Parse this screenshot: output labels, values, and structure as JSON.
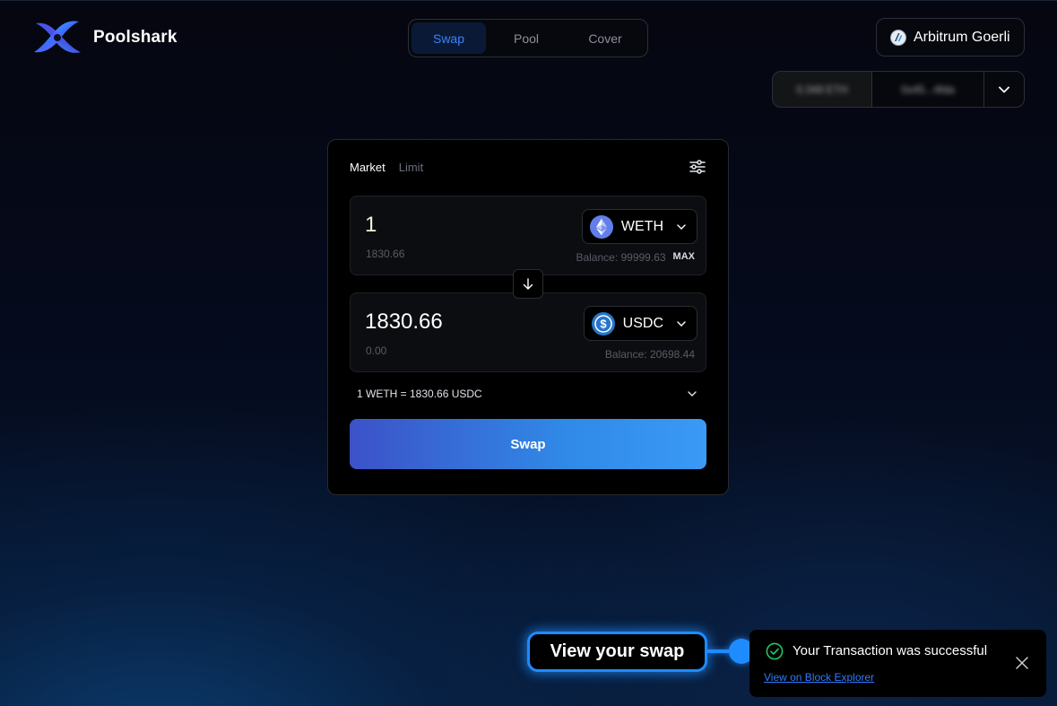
{
  "header": {
    "app_name": "Poolshark",
    "nav_tabs": [
      {
        "label": "Swap",
        "active": true
      },
      {
        "label": "Pool",
        "active": false
      },
      {
        "label": "Cover",
        "active": false
      }
    ],
    "network_label": "Arbitrum Goerli",
    "network_icon": "arbitrum-icon",
    "wallet_balance": "0.349 ETH",
    "wallet_address": "0x45...4fda"
  },
  "swap": {
    "mode_tabs": [
      "Market",
      "Limit"
    ],
    "active_mode": "Market",
    "from": {
      "amount": "1",
      "usd_value": "1830.66",
      "token": "WETH",
      "token_icon": "ethereum-icon",
      "balance_label": "Balance: 99999.63",
      "max_label": "MAX"
    },
    "to": {
      "amount": "1830.66",
      "usd_value": "0.00",
      "token": "USDC",
      "token_icon": "usdc-icon",
      "balance_label": "Balance: 20698.44"
    },
    "rate_text": "1 WETH = 1830.66 USDC",
    "button_label": "Swap"
  },
  "callout": {
    "text": "View your swap"
  },
  "toast": {
    "message": "Your Transaction was successful",
    "link_text": "View on Block Explorer",
    "status": "success"
  },
  "colors": {
    "accent": "#3b82f6",
    "callout": "#1e8bff",
    "success": "#22c55e",
    "button_start": "#3c52c8",
    "button_end": "#3a9af6"
  }
}
